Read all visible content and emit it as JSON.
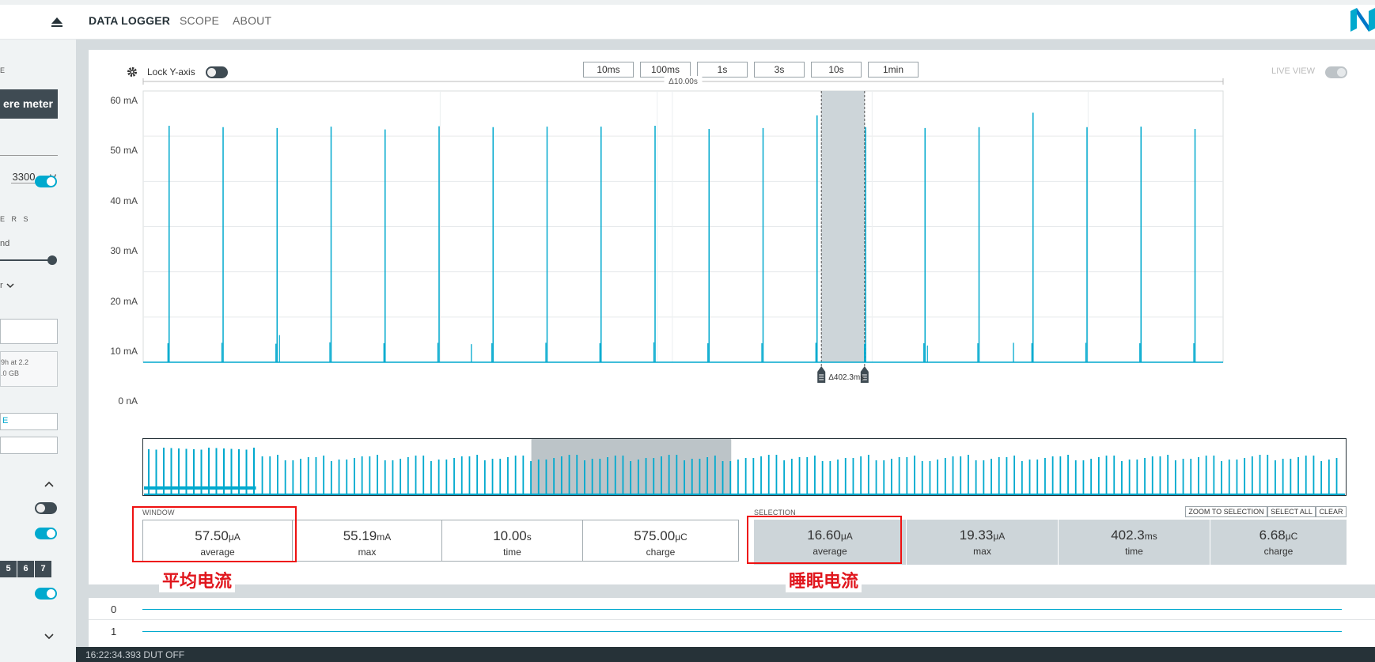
{
  "nav": {
    "items": [
      "DATA LOGGER",
      "SCOPE",
      "ABOUT"
    ],
    "active_index": 0
  },
  "sidebar": {
    "mode_heading": "E",
    "ampere_meter_label": "ere meter",
    "supply_voltage_value": "3300",
    "supply_voltage_unit": "mV",
    "power_output_on": true,
    "parameters_heading": "E R S",
    "sample_rate_label": "nd",
    "dropdown_label": "r",
    "info_line1": "9h at 2.2",
    "info_line2": ".0 GB",
    "field_fragment": "E",
    "channel_buttons": [
      "5",
      "6",
      "7"
    ],
    "digital_channels_on": true
  },
  "toolbar": {
    "lock_y_label": "Lock Y-axis",
    "lock_y_on": false,
    "window_ranges": [
      "10ms",
      "100ms",
      "1s",
      "3s",
      "10s",
      "1min"
    ],
    "live_view_label": "LIVE VIEW",
    "live_view_on": false
  },
  "chart_data": {
    "type": "line",
    "delta_label": "Δ10.00s",
    "selection_label": "Δ402.3ms",
    "y_ticks": [
      "60 mA",
      "50 mA",
      "40 mA",
      "30 mA",
      "20 mA",
      "10 mA",
      "0 nA"
    ],
    "ylim": [
      0,
      60
    ],
    "y_unit": "mA",
    "window_s": 10.0,
    "baseline_mA": 0.0,
    "spikes": [
      {
        "t": 0.24,
        "peak": 52.3,
        "base": 4.2
      },
      {
        "t": 0.74,
        "peak": 52.0,
        "base": 4.3
      },
      {
        "t": 1.24,
        "peak": 51.8,
        "base": 4.1,
        "shoulder": 6.0
      },
      {
        "t": 1.74,
        "peak": 52.1,
        "base": 4.4
      },
      {
        "t": 2.24,
        "peak": 51.5,
        "base": 4.2
      },
      {
        "t": 2.74,
        "peak": 52.2,
        "base": 4.3
      },
      {
        "t": 3.05,
        "peak": 0,
        "base": 4.0
      },
      {
        "t": 3.24,
        "peak": 52.0,
        "base": 4.2
      },
      {
        "t": 3.74,
        "peak": 52.1,
        "base": 4.3
      },
      {
        "t": 4.24,
        "peak": 52.1,
        "base": 4.2
      },
      {
        "t": 4.74,
        "peak": 52.3,
        "base": 4.4
      },
      {
        "t": 5.24,
        "peak": 51.6,
        "base": 4.2
      },
      {
        "t": 5.74,
        "peak": 51.8,
        "base": 4.2
      },
      {
        "t": 6.24,
        "peak": 54.6,
        "base": 4.3
      },
      {
        "t": 6.69,
        "peak": 52.0,
        "base": 4.1
      },
      {
        "t": 7.24,
        "peak": 51.8,
        "base": 4.2,
        "shoulder": 3.7
      },
      {
        "t": 7.74,
        "peak": 52.0,
        "base": 4.2
      },
      {
        "t": 8.07,
        "peak": 0,
        "base": 4.3
      },
      {
        "t": 8.24,
        "peak": 55.2,
        "base": 4.2
      },
      {
        "t": 8.74,
        "peak": 52.0,
        "base": 4.3
      },
      {
        "t": 9.24,
        "peak": 52.1,
        "base": 4.2
      },
      {
        "t": 9.74,
        "peak": 51.6,
        "base": 4.2
      }
    ],
    "selection_range_s": [
      6.28,
      6.68
    ]
  },
  "overview": {
    "window_range_fraction": [
      0.323,
      0.489
    ]
  },
  "stats": {
    "window_heading": "WINDOW",
    "selection_heading": "SELECTION",
    "window": [
      {
        "value": "57.50",
        "unit": "μA",
        "label": "average"
      },
      {
        "value": "55.19",
        "unit": "mA",
        "label": "max"
      },
      {
        "value": "10.00",
        "unit": "s",
        "label": "time"
      },
      {
        "value": "575.00",
        "unit": "μC",
        "label": "charge"
      }
    ],
    "selection": [
      {
        "value": "16.60",
        "unit": "μA",
        "label": "average"
      },
      {
        "value": "19.33",
        "unit": "μA",
        "label": "max"
      },
      {
        "value": "402.3",
        "unit": "ms",
        "label": "time"
      },
      {
        "value": "6.68",
        "unit": "μC",
        "label": "charge"
      }
    ],
    "buttons": [
      "ZOOM TO SELECTION",
      "SELECT ALL",
      "CLEAR"
    ]
  },
  "annotations": {
    "avg_current": "平均电流",
    "sleep_current": "睡眠电流"
  },
  "digital": {
    "channels": [
      "0",
      "1"
    ]
  },
  "statusbar": {
    "text": "16:22:34.393    DUT OFF"
  },
  "colors": {
    "accent": "#00a9ce",
    "dark": "#3f4b53",
    "selection": "#cdd5d9",
    "annotation": "#e0161d"
  }
}
